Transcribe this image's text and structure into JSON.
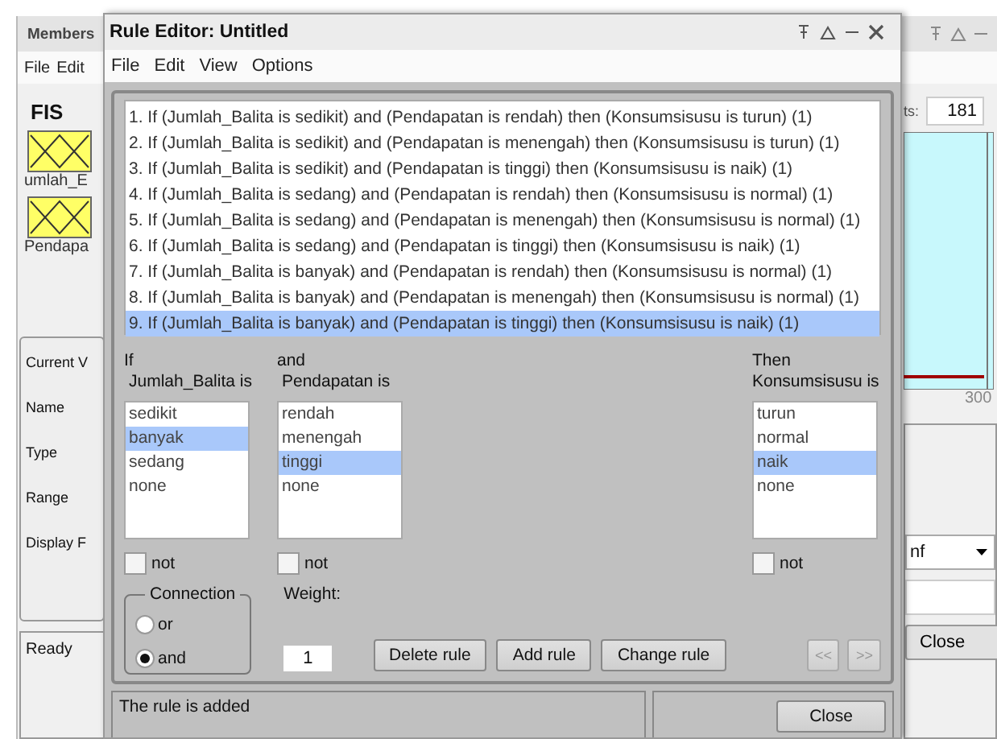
{
  "background_window": {
    "title": "Members",
    "menu": [
      "File",
      "Edit"
    ],
    "fis_label": "FIS",
    "variables": [
      {
        "name": "umlah_E"
      },
      {
        "name": "Pendapa"
      }
    ],
    "labels": [
      "Current V",
      "Name",
      "Type",
      "Range",
      "Display F"
    ],
    "status": "Ready",
    "count_label": "ts:",
    "count": "181",
    "axis_max": "300",
    "type_value": "nf",
    "close": "Close"
  },
  "rule_editor": {
    "title": "Rule Editor: Untitled",
    "menu": [
      "File",
      "Edit",
      "View",
      "Options"
    ],
    "rules": [
      {
        "text": "1. If (Jumlah_Balita is sedikit) and (Pendapatan is rendah) then (Konsumsisusu is turun) (1)",
        "selected": false
      },
      {
        "text": "2. If (Jumlah_Balita is sedikit) and (Pendapatan is menengah) then (Konsumsisusu is turun) (1)",
        "selected": false
      },
      {
        "text": "3. If (Jumlah_Balita is sedikit) and (Pendapatan is tinggi) then (Konsumsisusu is naik) (1)",
        "selected": false
      },
      {
        "text": "4. If (Jumlah_Balita is sedang) and (Pendapatan is rendah) then (Konsumsisusu is normal) (1)",
        "selected": false
      },
      {
        "text": "5. If (Jumlah_Balita is sedang) and (Pendapatan is menengah) then (Konsumsisusu is normal) (1)",
        "selected": false
      },
      {
        "text": "6. If (Jumlah_Balita is sedang) and (Pendapatan is tinggi) then (Konsumsisusu is naik) (1)",
        "selected": false
      },
      {
        "text": "7. If (Jumlah_Balita is banyak) and (Pendapatan is rendah) then (Konsumsisusu is normal) (1)",
        "selected": false
      },
      {
        "text": "8. If (Jumlah_Balita is banyak) and (Pendapatan is menengah) then (Konsumsisusu is normal) (1)",
        "selected": false
      },
      {
        "text": "9. If (Jumlah_Balita is banyak) and (Pendapatan is tinggi) then (Konsumsisusu is naik) (1)",
        "selected": true
      }
    ],
    "variables": [
      {
        "kind": "input",
        "heading": "If",
        "label": "Jumlah_Balita is",
        "options": [
          {
            "label": "sedikit",
            "selected": false
          },
          {
            "label": "banyak",
            "selected": true
          },
          {
            "label": "sedang",
            "selected": false
          },
          {
            "label": "none",
            "selected": false
          }
        ],
        "not_label": "not",
        "not": false
      },
      {
        "kind": "input",
        "heading": "and",
        "label": "Pendapatan is",
        "options": [
          {
            "label": "rendah",
            "selected": false
          },
          {
            "label": "menengah",
            "selected": false
          },
          {
            "label": "tinggi",
            "selected": true
          },
          {
            "label": "none",
            "selected": false
          }
        ],
        "not_label": "not",
        "not": false
      },
      {
        "kind": "output",
        "heading": "Then",
        "label": "Konsumsisusu is",
        "options": [
          {
            "label": "turun",
            "selected": false
          },
          {
            "label": "normal",
            "selected": false
          },
          {
            "label": "naik",
            "selected": true
          },
          {
            "label": "none",
            "selected": false
          }
        ],
        "not_label": "not",
        "not": false
      }
    ],
    "connection": {
      "title": "Connection",
      "options": [
        {
          "label": "or",
          "selected": false
        },
        {
          "label": "and",
          "selected": true
        }
      ]
    },
    "weight_label": "Weight:",
    "weight": "1",
    "buttons": [
      {
        "label": "Delete rule",
        "disabled": false
      },
      {
        "label": "Add rule",
        "disabled": false
      },
      {
        "label": "Change rule",
        "disabled": false
      }
    ],
    "nav_buttons": [
      {
        "label": "<<",
        "disabled": true
      },
      {
        "label": ">>",
        "disabled": true
      }
    ],
    "status": "The rule is added",
    "close": "Close"
  }
}
